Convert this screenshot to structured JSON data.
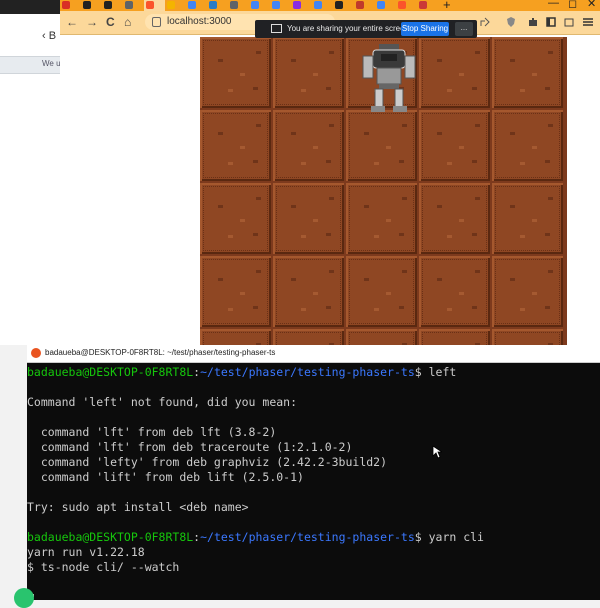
{
  "background_window": {
    "back_label": "‹ B",
    "banner_text": "We u"
  },
  "browser": {
    "tabs": [
      {
        "icon": "gmail-icon",
        "color": "#d93025"
      },
      {
        "icon": "github-icon",
        "color": "#222222"
      },
      {
        "icon": "github-icon",
        "color": "#222222"
      },
      {
        "icon": "page-icon",
        "color": "#5f6368"
      },
      {
        "icon": "brave-icon",
        "color": "#fb542b"
      },
      {
        "icon": "bookmark-icon",
        "color": "#f4b400"
      },
      {
        "icon": "google-icon",
        "color": "#4285f4"
      },
      {
        "icon": "vscode-icon",
        "color": "#2a7cc7"
      },
      {
        "icon": "page-icon",
        "color": "#5f6368"
      },
      {
        "icon": "google-icon",
        "color": "#4285f4"
      },
      {
        "icon": "google-icon",
        "color": "#4285f4"
      },
      {
        "icon": "phaser-icon",
        "color": "#8a2be2"
      },
      {
        "icon": "google-icon",
        "color": "#4285f4"
      },
      {
        "icon": "github-icon",
        "color": "#222222"
      },
      {
        "icon": "rust-icon",
        "color": "#c0392b"
      },
      {
        "icon": "google-icon",
        "color": "#4285f4"
      },
      {
        "icon": "brave-icon",
        "color": "#fb542b"
      },
      {
        "icon": "npm-icon",
        "color": "#cb3837"
      }
    ],
    "new_tab_label": "+",
    "window_controls": {
      "minimize": "—",
      "maximize": "◻",
      "close": "✕"
    },
    "nav": {
      "back": "←",
      "forward": "→",
      "reload": "C",
      "home": "⌂"
    },
    "url": "localhost:3000",
    "accent": "#f6a020"
  },
  "screen_share": {
    "message": "You are sharing your entire screen.",
    "stop_label": "Stop Sharing",
    "hide_label": "..."
  },
  "game": {
    "rows": 5,
    "cols": 5,
    "character": "robot-sprite"
  },
  "terminal": {
    "title": "badaueba@DESKTOP-0F8RT8L: ~/test/phaser/testing-phaser-ts",
    "lines": [
      {
        "user": "badaueba@DESKTOP-0F8RT8L",
        "path": "~/test/phaser/testing-phaser-ts",
        "cmd": "$ left"
      },
      {
        "text": ""
      },
      {
        "text": "Command 'left' not found, did you mean:"
      },
      {
        "text": ""
      },
      {
        "text": "  command 'lft' from deb lft (3.8-2)"
      },
      {
        "text": "  command 'lft' from deb traceroute (1:2.1.0-2)"
      },
      {
        "text": "  command 'lefty' from deb graphviz (2.42.2-3build2)"
      },
      {
        "text": "  command 'lift' from deb lift (2.5.0-1)"
      },
      {
        "text": ""
      },
      {
        "text": "Try: sudo apt install <deb name>"
      },
      {
        "text": ""
      },
      {
        "user": "badaueba@DESKTOP-0F8RT8L",
        "path": "~/test/phaser/testing-phaser-ts",
        "cmd": "$ yarn cli"
      },
      {
        "text": "yarn run v1.22.18"
      },
      {
        "text": "$ ts-node cli/ --watch"
      }
    ]
  }
}
